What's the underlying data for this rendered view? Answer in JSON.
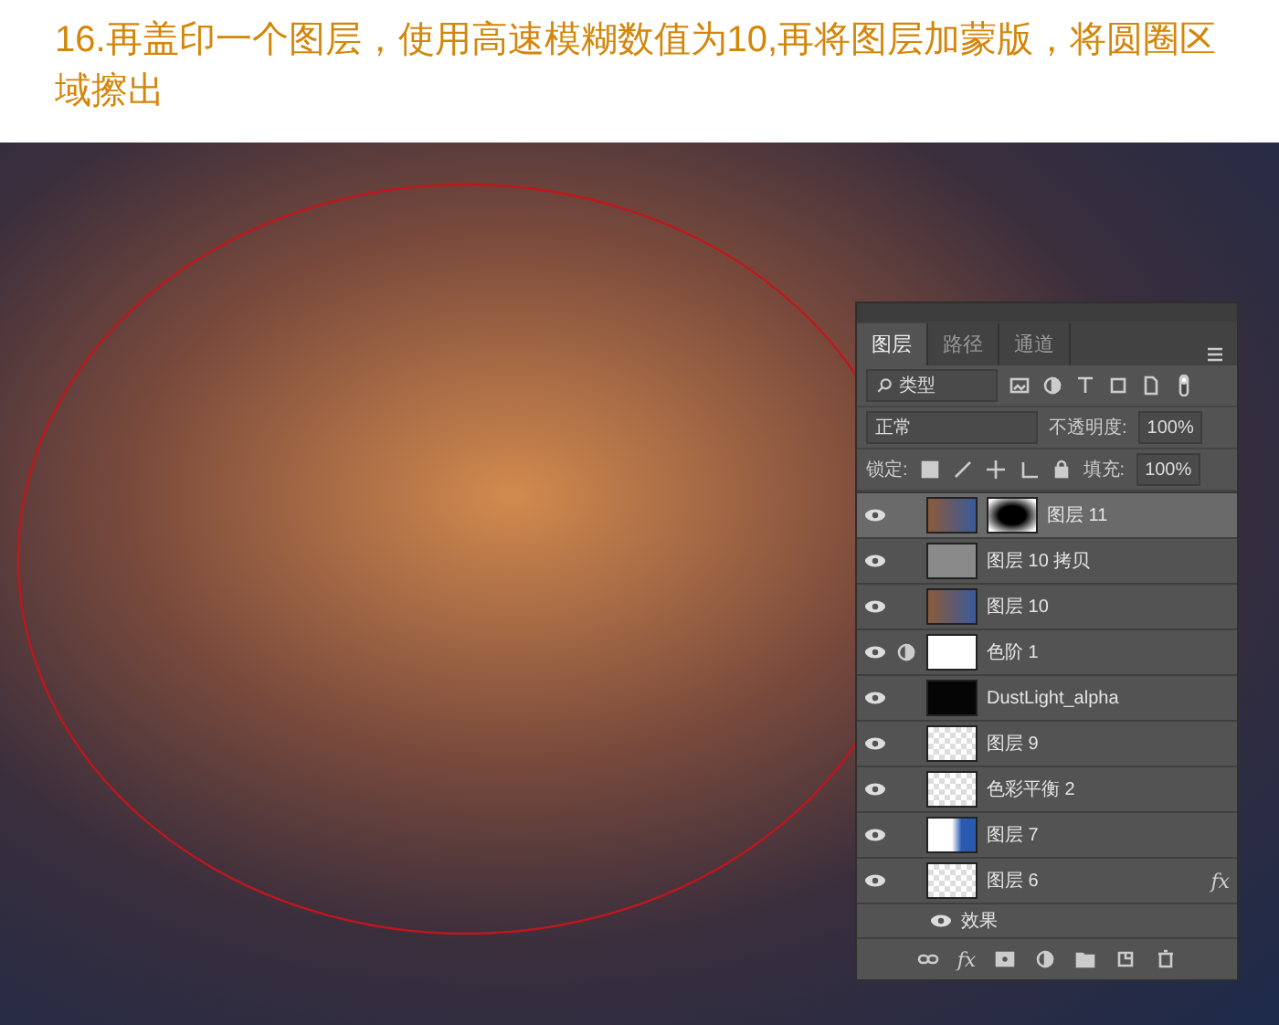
{
  "heading": "16.再盖印一个图层，使用高速模糊数值为10,再将图层加蒙版，将圆圈区域擦出",
  "panel": {
    "tabs": [
      {
        "label": "图层",
        "selected": true
      },
      {
        "label": "路径",
        "selected": false
      },
      {
        "label": "通道",
        "selected": false
      }
    ],
    "filter": {
      "value": "类型"
    },
    "blend": {
      "mode": "正常",
      "opacity_label": "不透明度:",
      "opacity": "100%"
    },
    "lock": {
      "label": "锁定:",
      "fill_label": "填充:",
      "fill": "100%"
    },
    "layers": [
      {
        "name": "图层 11",
        "kind": "photo",
        "mask": true,
        "adjust": false,
        "selected": true,
        "visible": true
      },
      {
        "name": "图层 10 拷贝",
        "kind": "gray",
        "mask": false,
        "adjust": false,
        "selected": false,
        "visible": true
      },
      {
        "name": "图层 10",
        "kind": "photo",
        "mask": false,
        "adjust": false,
        "selected": false,
        "visible": true
      },
      {
        "name": "色阶 1",
        "kind": "white",
        "mask": false,
        "adjust": true,
        "selected": false,
        "visible": true
      },
      {
        "name": "DustLight_alpha",
        "kind": "dark",
        "mask": false,
        "adjust": false,
        "selected": false,
        "visible": true
      },
      {
        "name": "图层 9",
        "kind": "checker",
        "mask": false,
        "adjust": false,
        "selected": false,
        "visible": true
      },
      {
        "name": "色彩平衡 2",
        "kind": "checker",
        "mask": false,
        "adjust": false,
        "selected": false,
        "visible": true
      },
      {
        "name": "图层 7",
        "kind": "blue",
        "mask": false,
        "adjust": false,
        "selected": false,
        "visible": true
      },
      {
        "name": "图层 6",
        "kind": "checker",
        "mask": false,
        "adjust": false,
        "fx": "fx",
        "selected": false,
        "visible": true,
        "children": [
          {
            "name": "效果",
            "visible": true
          }
        ]
      }
    ],
    "footer_fx": "fx"
  }
}
